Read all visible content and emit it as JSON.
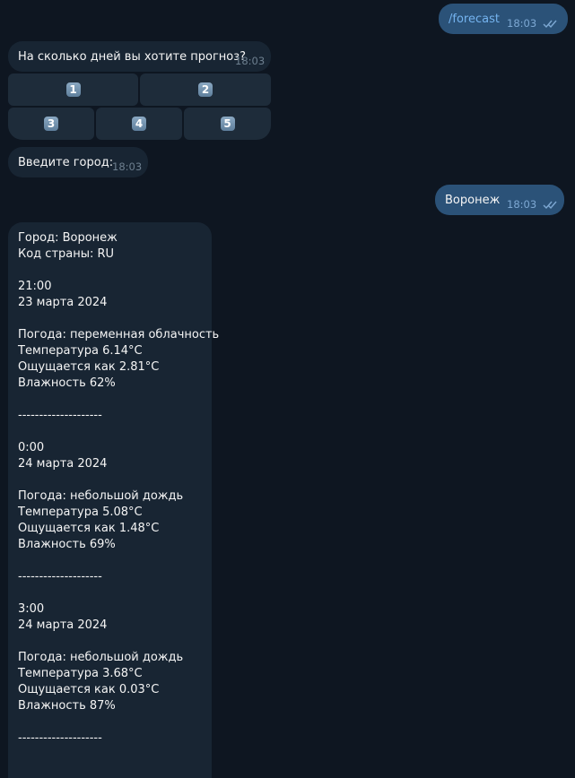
{
  "messages": {
    "cmd": {
      "text": "/forecast",
      "time": "18:03"
    },
    "question": {
      "text": "На сколько дней вы хотите прогноз?",
      "time": "18:03"
    },
    "keyboard": [
      "1",
      "2",
      "3",
      "4",
      "5"
    ],
    "city_prompt": {
      "text": "Введите город:",
      "time": "18:03"
    },
    "city_reply": {
      "text": "Воронеж",
      "time": "18:03"
    },
    "forecast": {
      "lines": [
        "Город: Воронеж",
        "Код страны: RU",
        "",
        "21:00",
        "23 марта 2024",
        "",
        "Погода: переменная облачность",
        "Температура 6.14°C",
        "Ощущается как 2.81°C",
        "Влажность 62%",
        "",
        "--------------------",
        "",
        "0:00",
        "24 марта 2024",
        "",
        "Погода: небольшой дождь",
        "Температура 5.08°C",
        "Ощущается как 1.48°C",
        "Влажность 69%",
        "",
        "--------------------",
        "",
        "3:00",
        "24 марта 2024",
        "",
        "Погода: небольшой дождь",
        "Температура 3.68°C",
        "Ощущается как 0.03°C",
        "Влажность 87%",
        "",
        "--------------------"
      ]
    }
  },
  "colors": {
    "background": "#0e1621",
    "incoming": "#182533",
    "outgoing": "#2b5278",
    "command": "#74b3ef"
  }
}
